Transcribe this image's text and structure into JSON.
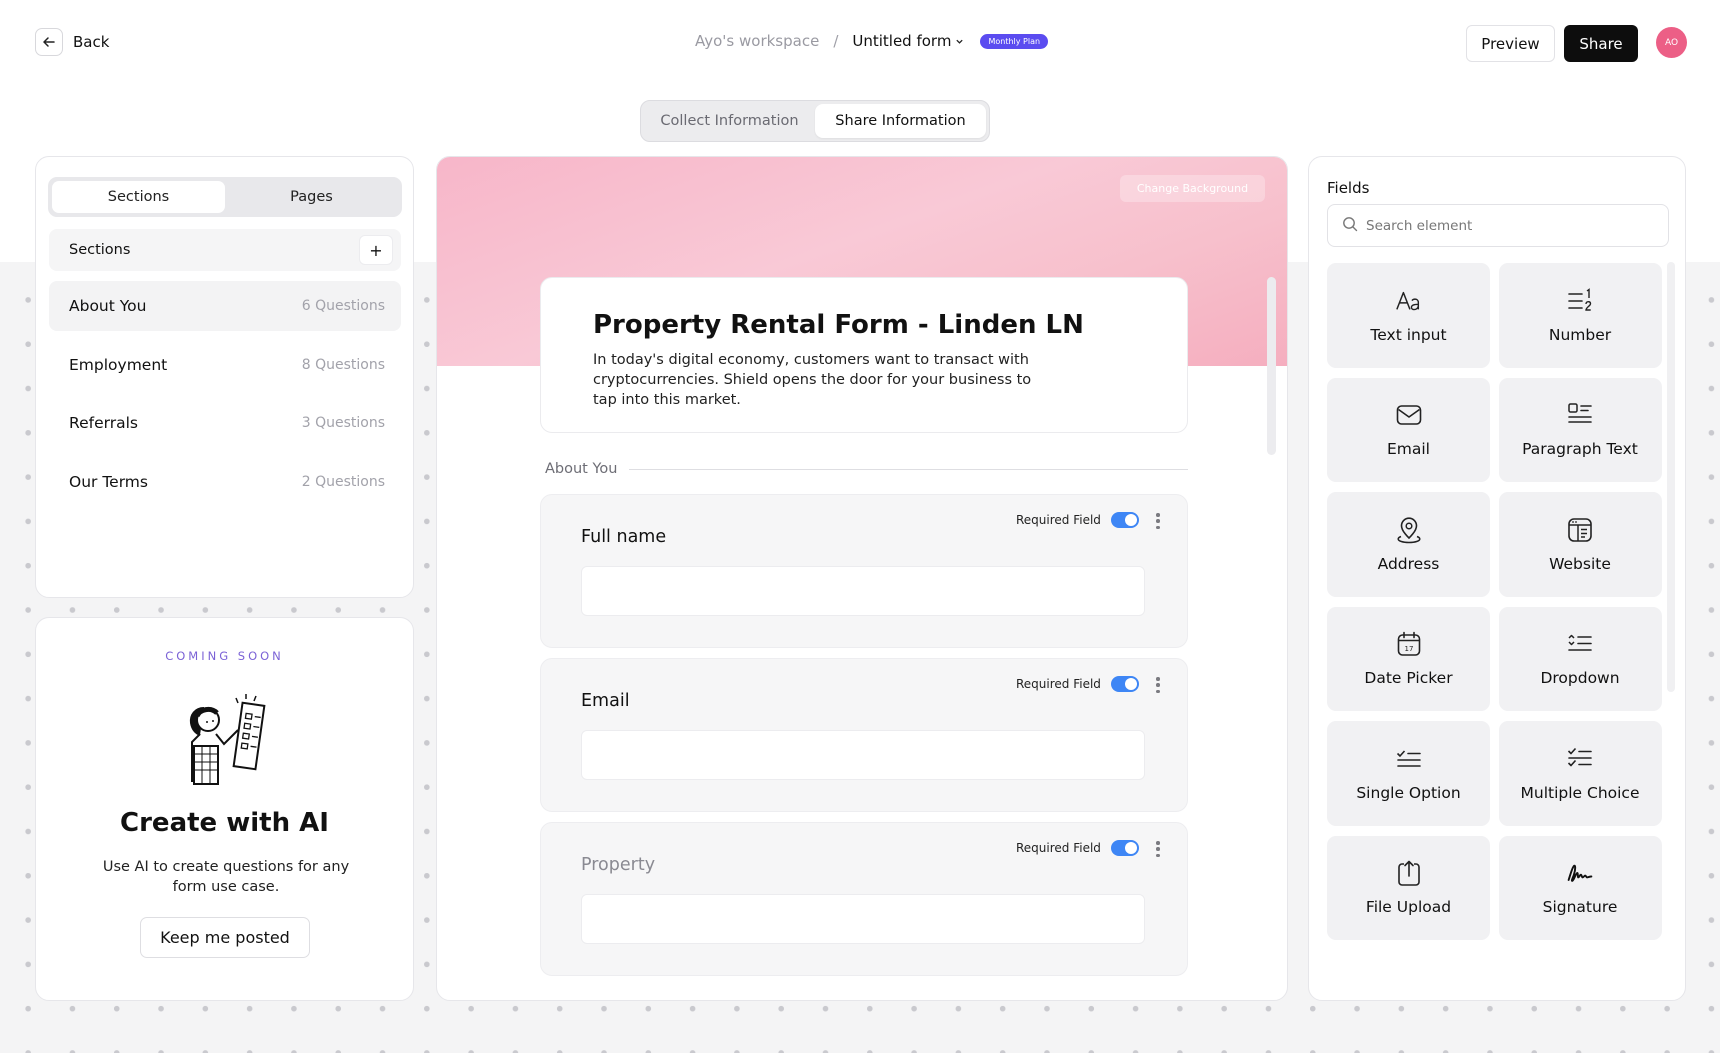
{
  "header": {
    "back_label": "Back",
    "workspace": "Ayo's workspace",
    "separator": "/",
    "form_name": "Untitled form",
    "plan_badge": "Monthly Plan",
    "preview_label": "Preview",
    "share_label": "Share",
    "avatar_initials": "AO"
  },
  "mode_tabs": [
    "Collect Information",
    "Share Information"
  ],
  "left": {
    "seg_tabs": [
      "Sections",
      "Pages"
    ],
    "sections_header": "Sections",
    "add_symbol": "+",
    "sections": [
      {
        "name": "About You",
        "count": "6 Questions"
      },
      {
        "name": "Employment",
        "count": "8 Questions"
      },
      {
        "name": "Referrals",
        "count": "3 Questions"
      },
      {
        "name": "Our Terms",
        "count": "2 Questions"
      }
    ]
  },
  "ai": {
    "coming_soon": "COMING SOON",
    "title": "Create with AI",
    "description": "Use AI to create questions for any form use case.",
    "button": "Keep me posted"
  },
  "form": {
    "change_background": "Change Background",
    "title": "Property Rental Form - Linden LN",
    "description": "In today's digital economy, customers want to transact with cryptocurrencies. Shield opens the door for your business to tap into this market.",
    "section_label": "About You",
    "required_label": "Required Field",
    "fields": [
      {
        "label": "Full name",
        "required": true
      },
      {
        "label": "Email",
        "required": true
      },
      {
        "label": "Property",
        "required": true
      }
    ]
  },
  "right": {
    "title": "Fields",
    "search_placeholder": "Search element",
    "tiles": [
      {
        "label": "Text input",
        "icon": "text-aa-icon"
      },
      {
        "label": "Number",
        "icon": "number-list-icon"
      },
      {
        "label": "Email",
        "icon": "envelope-icon"
      },
      {
        "label": "Paragraph Text",
        "icon": "paragraph-icon"
      },
      {
        "label": "Address",
        "icon": "location-pin-icon"
      },
      {
        "label": "Website",
        "icon": "browser-window-icon"
      },
      {
        "label": "Date Picker",
        "icon": "calendar-icon"
      },
      {
        "label": "Dropdown",
        "icon": "dropdown-list-icon"
      },
      {
        "label": "Single Option",
        "icon": "single-check-list-icon"
      },
      {
        "label": "Multiple Choice",
        "icon": "multi-check-list-icon"
      },
      {
        "label": "File Upload",
        "icon": "file-upload-icon"
      },
      {
        "label": "Signature",
        "icon": "signature-icon"
      }
    ]
  },
  "colors": {
    "accent_blue": "#3e86f5",
    "badge_purple": "#5b4cf0",
    "avatar_pink": "#ec5f86",
    "coming_soon_purple": "#7b62d6"
  }
}
